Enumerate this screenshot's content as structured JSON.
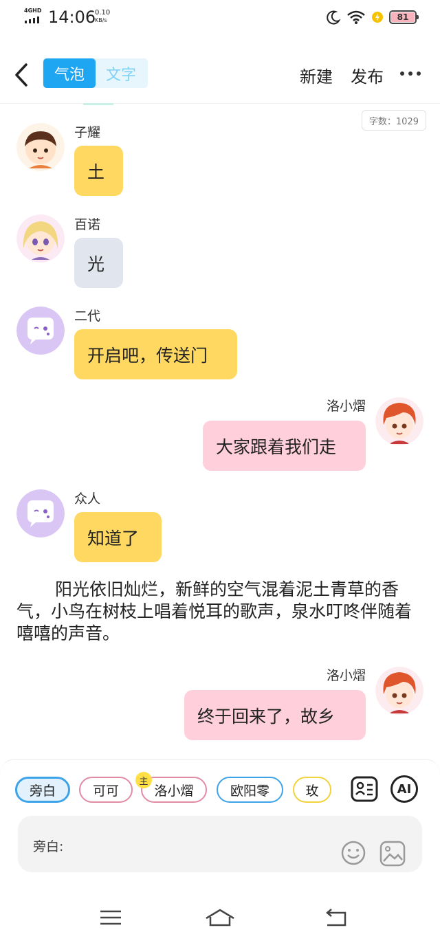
{
  "status_bar": {
    "network": "4GHD",
    "time": "14:06",
    "speed_value": "0.10",
    "speed_unit": "KB/s",
    "battery": "81"
  },
  "header": {
    "tabs": [
      {
        "label": "气泡",
        "active": true
      },
      {
        "label": "文字",
        "active": false
      }
    ],
    "new_label": "新建",
    "publish_label": "发布"
  },
  "word_count": "字数：1029",
  "messages": [
    {
      "sender": "子耀",
      "text": "土",
      "side": "left",
      "color": "yellow",
      "avatar_icon": "boy-avatar-icon"
    },
    {
      "sender": "百诺",
      "text": "光",
      "side": "left",
      "color": "gray",
      "avatar_icon": "blonde-girl-avatar-icon"
    },
    {
      "sender": "二代",
      "text": "开启吧，传送门",
      "side": "left",
      "color": "yellow",
      "avatar_icon": "chat-bubble-avatar-icon"
    },
    {
      "sender": "洛小熠",
      "text": "大家跟着我们走",
      "side": "right",
      "color": "pink",
      "avatar_icon": "red-hair-boy-avatar-icon"
    },
    {
      "sender": "众人",
      "text": "知道了",
      "side": "left",
      "color": "yellow",
      "avatar_icon": "chat-bubble-avatar-icon"
    },
    {
      "sender": "洛小熠",
      "text": "终于回来了，故乡",
      "side": "right",
      "color": "pink",
      "avatar_icon": "red-hair-boy-avatar-icon"
    }
  ],
  "narration": "阳光依旧灿烂，新鲜的空气混着泥土青草的香气，小鸟在树枝上唱着悦耳的歌声，泉水叮咚伴随着嘻嘻的声音。",
  "composer": {
    "roles": [
      {
        "label": "旁白",
        "border": "#3da3e8",
        "active": true
      },
      {
        "label": "可可",
        "border": "#e38aa4",
        "active": false
      },
      {
        "label": "洛小熠",
        "border": "#e38aa4",
        "active": false
      },
      {
        "label": "欧阳零",
        "border": "#3da3e8",
        "active": false
      },
      {
        "label": "玫",
        "border": "#f1d23a",
        "active": false
      }
    ],
    "host_badge": "主",
    "ai_label": "AI",
    "input_label": "旁白:",
    "input_value": ""
  },
  "colors": {
    "accent_blue": "#1fa6f2",
    "bubble_yellow": "#ffd861",
    "bubble_gray": "#e1e6ee",
    "bubble_pink": "#ffcfdc"
  }
}
